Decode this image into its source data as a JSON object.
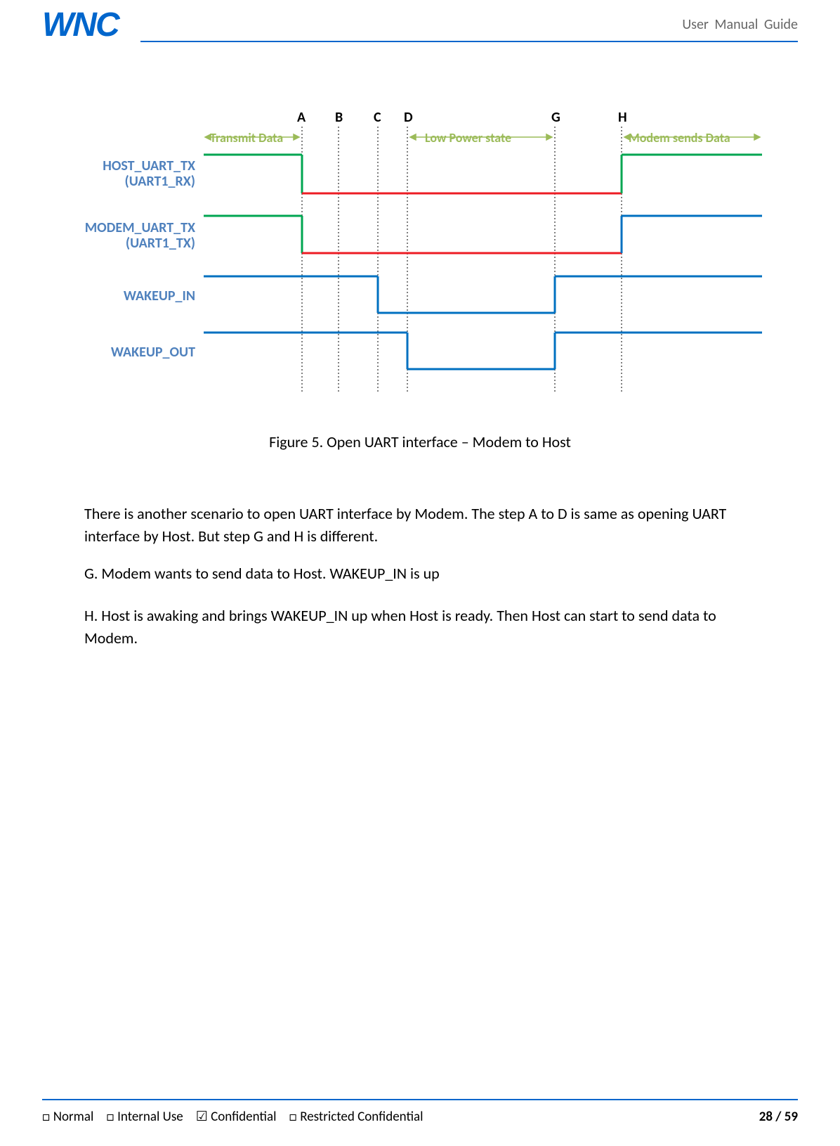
{
  "header": {
    "logo": "WNC",
    "doc_title": "User  Manual  Guide"
  },
  "diagram": {
    "markers": {
      "A": "A",
      "B": "B",
      "C": "C",
      "D": "D",
      "G": "G",
      "H": "H"
    },
    "phases": {
      "transmit": "Transmit Data",
      "lowpower": "Low Power state",
      "modemsends": "Modem sends Data"
    },
    "signals": {
      "host_tx_l1": "HOST_UART_TX",
      "host_tx_l2": "(UART1_RX)",
      "modem_tx_l1": "MODEM_UART_TX",
      "modem_tx_l2": "(UART1_TX)",
      "wakeup_in": "WAKEUP_IN",
      "wakeup_out": "WAKEUP_OUT"
    }
  },
  "figure_caption": "Figure 5.  Open UART interface – Modem to Host",
  "paragraphs": {
    "p1": "There is another scenario to open UART interface by Modem. The step A to D is same as opening UART interface by Host. But step G and H is different.",
    "p2": "G. Modem wants to send data to Host. WAKEUP_IN is up",
    "p3": "H. Host is awaking and brings WAKEUP_IN up when Host is ready. Then Host can start to send data to Modem."
  },
  "footer": {
    "normal": "□ Normal",
    "internal": "□ Internal Use",
    "confidential": "☑ Confidential",
    "restricted": "□ Restricted Confidential",
    "page": "28 / 59"
  },
  "chart_data": {
    "type": "timing-diagram",
    "time_markers": [
      "A",
      "B",
      "C",
      "D",
      "G",
      "H"
    ],
    "phases": [
      {
        "label": "Transmit Data",
        "from_start_to": "A"
      },
      {
        "label": "Low Power state",
        "from": "D",
        "to": "G"
      },
      {
        "label": "Modem sends Data",
        "from": "H",
        "to_end": true
      }
    ],
    "signals": [
      {
        "name": "HOST_UART_TX (UART1_RX)",
        "segments": [
          {
            "state": "active-data",
            "from": "start",
            "to": "A",
            "color": "green"
          },
          {
            "state": "low",
            "from": "A",
            "to": "H",
            "color": "red"
          },
          {
            "state": "active-data",
            "from": "H",
            "to": "end",
            "color": "green"
          }
        ]
      },
      {
        "name": "MODEM_UART_TX (UART1_TX)",
        "segments": [
          {
            "state": "active-data",
            "from": "start",
            "to": "A",
            "color": "green"
          },
          {
            "state": "low",
            "from": "A",
            "to": "H",
            "color": "red"
          },
          {
            "state": "high",
            "from": "H",
            "to": "end",
            "color": "blue"
          }
        ]
      },
      {
        "name": "WAKEUP_IN",
        "segments": [
          {
            "state": "high",
            "from": "start",
            "to": "C",
            "color": "blue"
          },
          {
            "state": "low",
            "from": "C",
            "to": "G",
            "color": "blue"
          },
          {
            "state": "high",
            "from": "G",
            "to": "end",
            "color": "blue"
          }
        ]
      },
      {
        "name": "WAKEUP_OUT",
        "segments": [
          {
            "state": "high",
            "from": "start",
            "to": "D",
            "color": "blue"
          },
          {
            "state": "low",
            "from": "D",
            "to": "G",
            "color": "blue"
          },
          {
            "state": "high",
            "from": "G",
            "to": "end",
            "color": "blue"
          }
        ]
      }
    ]
  }
}
